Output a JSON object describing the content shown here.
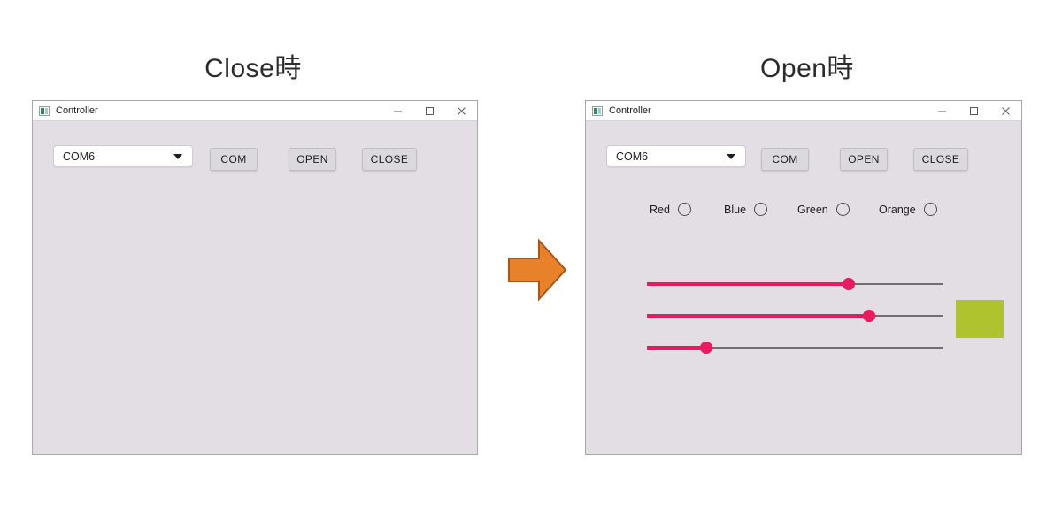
{
  "page": {
    "background": "#ffffff",
    "arrow": {
      "name": "right-arrow",
      "fill": "#E8822A",
      "stroke": "#A8551B"
    }
  },
  "captions": {
    "close_state": "Close時",
    "open_state": "Open時"
  },
  "colors": {
    "window_client_bg": "#E2DEE3",
    "titlebar_bg": "#FFFFFF",
    "window_border": "#A8A5AE",
    "button_bg": "#DCD9DE",
    "button_border": "#C2BEC6",
    "combo_bg": "#FFFFFF",
    "slider_fill": "#EA1A5F",
    "slider_track": "#6F6F72",
    "slider_thumb": "#EA1A5F",
    "color_swatch": "#AFC32E",
    "radio_outline": "#4A4A4A",
    "text": "#1C1C1C"
  },
  "window_close": {
    "titlebar": {
      "icon": "app-icon",
      "title": "Controller",
      "minimize": "minimize-icon",
      "maximize": "maximize-icon",
      "close": "close-icon"
    },
    "combo": {
      "value": "COM6",
      "placeholder": "COM6",
      "arrow_icon": "chevron-down-icon"
    },
    "buttons": {
      "com": "COM",
      "open": "OPEN",
      "close": "CLOSE"
    }
  },
  "window_open": {
    "titlebar": {
      "icon": "app-icon",
      "title": "Controller",
      "minimize": "minimize-icon",
      "maximize": "maximize-icon",
      "close": "close-icon"
    },
    "combo": {
      "value": "COM6",
      "placeholder": "COM6",
      "arrow_icon": "chevron-down-icon"
    },
    "buttons": {
      "com": "COM",
      "open": "OPEN",
      "close": "CLOSE"
    },
    "radios": [
      {
        "label": "Red",
        "selected": false
      },
      {
        "label": "Blue",
        "selected": false
      },
      {
        "label": "Green",
        "selected": false
      },
      {
        "label": "Orange",
        "selected": false
      }
    ],
    "sliders": [
      {
        "name": "slider-1",
        "percent": 68
      },
      {
        "name": "slider-2",
        "percent": 75
      },
      {
        "name": "slider-3",
        "percent": 20
      }
    ],
    "color_preview": {
      "name": "color-preview-swatch",
      "color": "#AFC32E"
    }
  }
}
